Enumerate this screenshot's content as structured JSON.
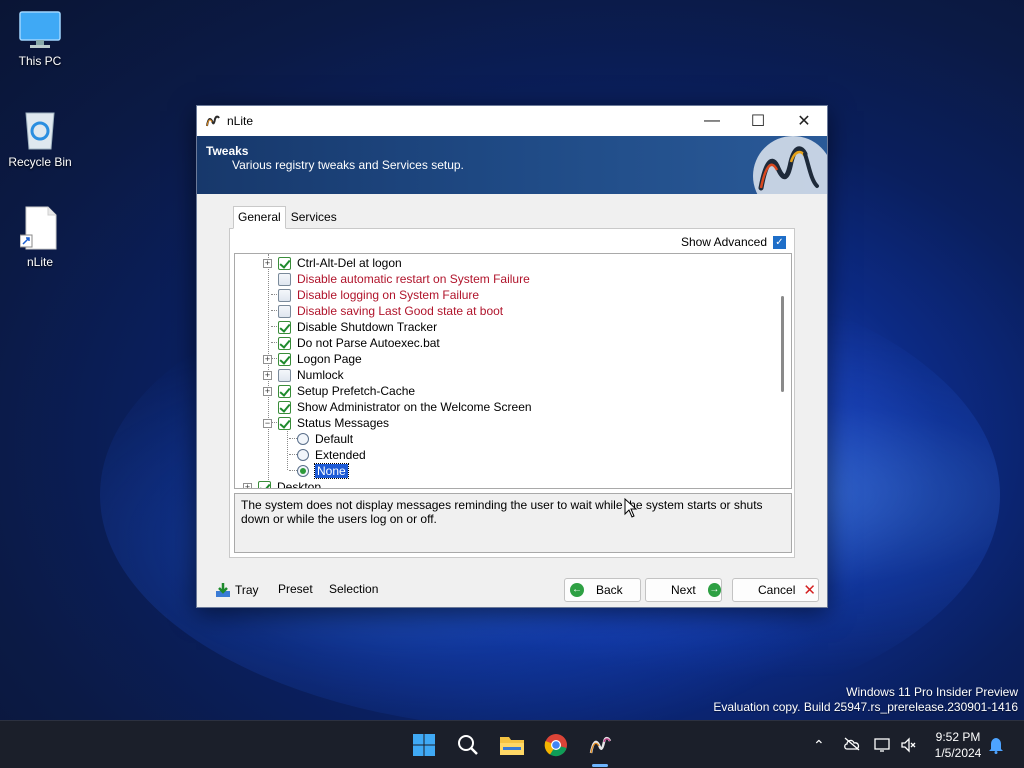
{
  "desktop": {
    "icons": [
      {
        "label": "This PC",
        "icon": "monitor-icon"
      },
      {
        "label": "Recycle Bin",
        "icon": "recycle-bin-icon"
      },
      {
        "label": "nLite",
        "icon": "shortcut-file-icon"
      }
    ],
    "watermark_line1": "Windows 11 Pro Insider Preview",
    "watermark_line2": "Evaluation copy. Build 25947.rs_prerelease.230901-1416"
  },
  "window": {
    "title": "nLite",
    "controls": {
      "minimize": "—",
      "maximize": "☐",
      "close": "✕"
    },
    "banner": {
      "title": "Tweaks",
      "subtitle": "Various registry tweaks and Services setup."
    },
    "tabs": [
      {
        "label": "General",
        "active": true
      },
      {
        "label": "Services",
        "active": false
      }
    ],
    "show_advanced": {
      "label": "Show Advanced",
      "checked": true
    },
    "tree": {
      "items": [
        {
          "label": "Ctrl-Alt-Del at logon",
          "checked": true,
          "expandable": true,
          "red": false
        },
        {
          "label": "Disable automatic restart on System Failure",
          "checked": false,
          "expandable": false,
          "red": true
        },
        {
          "label": "Disable logging on System Failure",
          "checked": false,
          "expandable": false,
          "red": true
        },
        {
          "label": "Disable saving Last Good state at boot",
          "checked": false,
          "expandable": false,
          "red": true
        },
        {
          "label": "Disable Shutdown Tracker",
          "checked": true,
          "expandable": false,
          "red": false
        },
        {
          "label": "Do not Parse Autoexec.bat",
          "checked": true,
          "expandable": false,
          "red": false
        },
        {
          "label": "Logon Page",
          "checked": true,
          "expandable": true,
          "red": false
        },
        {
          "label": "Numlock",
          "checked": false,
          "expandable": true,
          "red": false
        },
        {
          "label": "Setup Prefetch-Cache",
          "checked": true,
          "expandable": true,
          "red": false
        },
        {
          "label": "Show Administrator on the Welcome Screen",
          "checked": true,
          "expandable": false,
          "red": false
        },
        {
          "label": "Status Messages",
          "checked": true,
          "expandable": true,
          "expanded": true,
          "red": false
        }
      ],
      "radio_options": [
        {
          "label": "Default",
          "selected": false
        },
        {
          "label": "Extended",
          "selected": false
        },
        {
          "label": "None",
          "selected": true
        }
      ],
      "next_group": "Desktop"
    },
    "description": "The system does not display messages reminding the user to wait while the system starts or shuts down or while the users log on or off.",
    "footer": {
      "tray": "Tray",
      "preset": "Preset",
      "selection": "Selection",
      "back": "Back",
      "next": "Next",
      "cancel": "Cancel"
    }
  },
  "taskbar": {
    "apps": [
      "start-icon",
      "search-icon",
      "file-explorer-icon",
      "chrome-icon",
      "nlite-icon"
    ],
    "clock_time": "9:52 PM",
    "clock_date": "1/5/2024"
  }
}
